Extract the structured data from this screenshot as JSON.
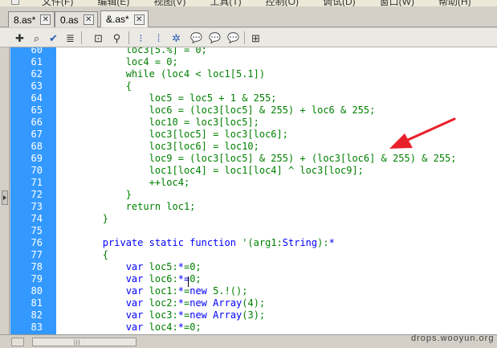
{
  "menu": {
    "items": [
      "文件(F)",
      "编辑(E)",
      "视图(V)",
      "工具(T)",
      "控制(O)",
      "调试(D)",
      "窗口(W)",
      "帮助(H)"
    ]
  },
  "tabs": [
    {
      "label": "8.as*",
      "active": false
    },
    {
      "label": "0.as",
      "active": false
    },
    {
      "label": "&.as*",
      "active": true
    }
  ],
  "toolbar": {
    "icons": [
      "add-statement-icon",
      "find-icon",
      "check-syntax-icon",
      "auto-format-icon",
      "code-hint-icon",
      "debug-options-icon",
      "collapse-between-braces-icon",
      "collapse-selection-icon",
      "expand-all-icon",
      "apply-block-comment-icon",
      "apply-line-comment-icon",
      "remove-comment-icon",
      "show-hide-toolbox-icon"
    ]
  },
  "editor": {
    "lines": [
      {
        "n": "60",
        "segs": [
          [
            "c",
            "            loc3[5.%] = 0;"
          ]
        ]
      },
      {
        "n": "61",
        "segs": [
          [
            "c",
            "            loc4 = 0;"
          ]
        ]
      },
      {
        "n": "62",
        "segs": [
          [
            "c",
            "            while (loc4 < loc1[5.1])"
          ]
        ]
      },
      {
        "n": "63",
        "segs": [
          [
            "c",
            "            {"
          ]
        ]
      },
      {
        "n": "64",
        "segs": [
          [
            "c",
            "                loc5 = loc5 + 1 & 255;"
          ]
        ]
      },
      {
        "n": "65",
        "segs": [
          [
            "c",
            "                loc6 = (loc3[loc5] & 255) + loc6 & 255;"
          ]
        ]
      },
      {
        "n": "66",
        "segs": [
          [
            "c",
            "                loc10 = loc3[loc5];"
          ]
        ]
      },
      {
        "n": "67",
        "segs": [
          [
            "c",
            "                loc3[loc5] = loc3[loc6];"
          ]
        ]
      },
      {
        "n": "68",
        "segs": [
          [
            "c",
            "                loc3[loc6] = loc10;"
          ]
        ]
      },
      {
        "n": "69",
        "segs": [
          [
            "c",
            "                loc9 = (loc3[loc5] & 255) + (loc3[loc6] & 255) & 255;"
          ]
        ]
      },
      {
        "n": "70",
        "segs": [
          [
            "c",
            "                loc1[loc4] = loc1[loc4] ^ loc3[loc9];"
          ]
        ]
      },
      {
        "n": "71",
        "segs": [
          [
            "c",
            "                ++loc4;"
          ]
        ]
      },
      {
        "n": "72",
        "segs": [
          [
            "c",
            "            }"
          ]
        ]
      },
      {
        "n": "73",
        "segs": [
          [
            "c",
            "            return loc1;"
          ]
        ]
      },
      {
        "n": "74",
        "segs": [
          [
            "c",
            "        }"
          ]
        ]
      },
      {
        "n": "75",
        "segs": []
      },
      {
        "n": "76",
        "segs": [
          [
            "c",
            "        "
          ],
          [
            "k",
            "private static function"
          ],
          [
            "c",
            " '("
          ],
          [
            "c",
            "arg1:"
          ],
          [
            "k",
            "String"
          ],
          [
            "c",
            "):"
          ],
          [
            "o",
            "*"
          ]
        ]
      },
      {
        "n": "77",
        "segs": [
          [
            "c",
            "        {"
          ]
        ]
      },
      {
        "n": "78",
        "segs": [
          [
            "c",
            "            "
          ],
          [
            "k",
            "var"
          ],
          [
            "c",
            " loc5:"
          ],
          [
            "o",
            "*"
          ],
          [
            "c",
            "=0;"
          ]
        ]
      },
      {
        "n": "79",
        "segs": [
          [
            "c",
            "            "
          ],
          [
            "k",
            "var"
          ],
          [
            "c",
            " loc6:"
          ],
          [
            "o",
            "*="
          ],
          [
            "c",
            "0;"
          ]
        ]
      },
      {
        "n": "80",
        "segs": [
          [
            "c",
            "            "
          ],
          [
            "k",
            "var"
          ],
          [
            "c",
            " loc1:"
          ],
          [
            "o",
            "*"
          ],
          [
            "c",
            "="
          ],
          [
            "k",
            "new"
          ],
          [
            "c",
            " 5.!();"
          ]
        ]
      },
      {
        "n": "81",
        "segs": [
          [
            "c",
            "            "
          ],
          [
            "k",
            "var"
          ],
          [
            "c",
            " loc2:"
          ],
          [
            "o",
            "*"
          ],
          [
            "c",
            "="
          ],
          [
            "k",
            "new"
          ],
          [
            "c",
            " "
          ],
          [
            "k",
            "Array"
          ],
          [
            "c",
            "(4);"
          ]
        ]
      },
      {
        "n": "82",
        "segs": [
          [
            "c",
            "            "
          ],
          [
            "k",
            "var"
          ],
          [
            "c",
            " loc3:"
          ],
          [
            "o",
            "*"
          ],
          [
            "c",
            "="
          ],
          [
            "k",
            "new"
          ],
          [
            "c",
            " "
          ],
          [
            "k",
            "Array"
          ],
          [
            "c",
            "(3);"
          ]
        ]
      },
      {
        "n": "83",
        "segs": [
          [
            "c",
            "            "
          ],
          [
            "k",
            "var"
          ],
          [
            "c",
            " loc4:"
          ],
          [
            "o",
            "*"
          ],
          [
            "c",
            "=0;"
          ]
        ]
      }
    ]
  },
  "watermark": "drops.wooyun.org",
  "colors": {
    "gutter": "#3399ff",
    "code": "#008000",
    "keyword": "#0000ff",
    "annotation_arrow": "#e8202a"
  }
}
